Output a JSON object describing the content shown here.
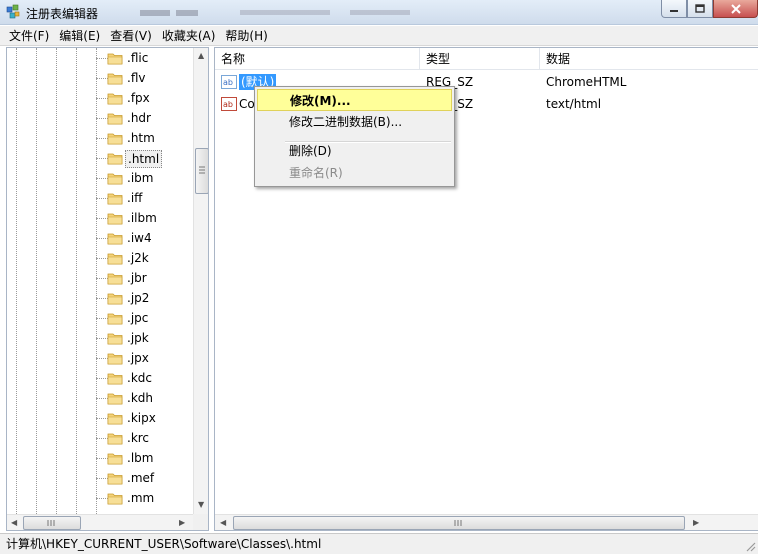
{
  "window": {
    "title": "注册表编辑器"
  },
  "menubar": {
    "items": [
      "文件(F)",
      "编辑(E)",
      "查看(V)",
      "收藏夹(A)",
      "帮助(H)"
    ]
  },
  "tree": {
    "items": [
      ".flic",
      ".flv",
      ".fpx",
      ".hdr",
      ".htm",
      ".html",
      ".ibm",
      ".iff",
      ".ilbm",
      ".iw4",
      ".j2k",
      ".jbr",
      ".jp2",
      ".jpc",
      ".jpk",
      ".jpx",
      ".kdc",
      ".kdh",
      ".kipx",
      ".krc",
      ".lbm",
      ".mef",
      ".mm"
    ],
    "selected": ".html"
  },
  "list": {
    "columns": {
      "name": "名称",
      "type": "类型",
      "data": "数据"
    },
    "rows": [
      {
        "name": "(默认)",
        "type": "REG_SZ",
        "data": "ChromeHTML"
      },
      {
        "name": "Co",
        "type": "REG_SZ",
        "data": "text/html"
      }
    ]
  },
  "context_menu": {
    "modify": "修改(M)...",
    "modify_binary": "修改二进制数据(B)...",
    "delete": "删除(D)",
    "rename": "重命名(R)"
  },
  "statusbar": {
    "path": "计算机\\HKEY_CURRENT_USER\\Software\\Classes\\.html"
  },
  "colors": {
    "selection": "#3399ff",
    "menu_highlight": "#ffff99",
    "close_button": "#c75050"
  },
  "icons": {
    "app": "registry-editor-icon",
    "folder": "folder-icon",
    "value": "string-value-icon"
  }
}
